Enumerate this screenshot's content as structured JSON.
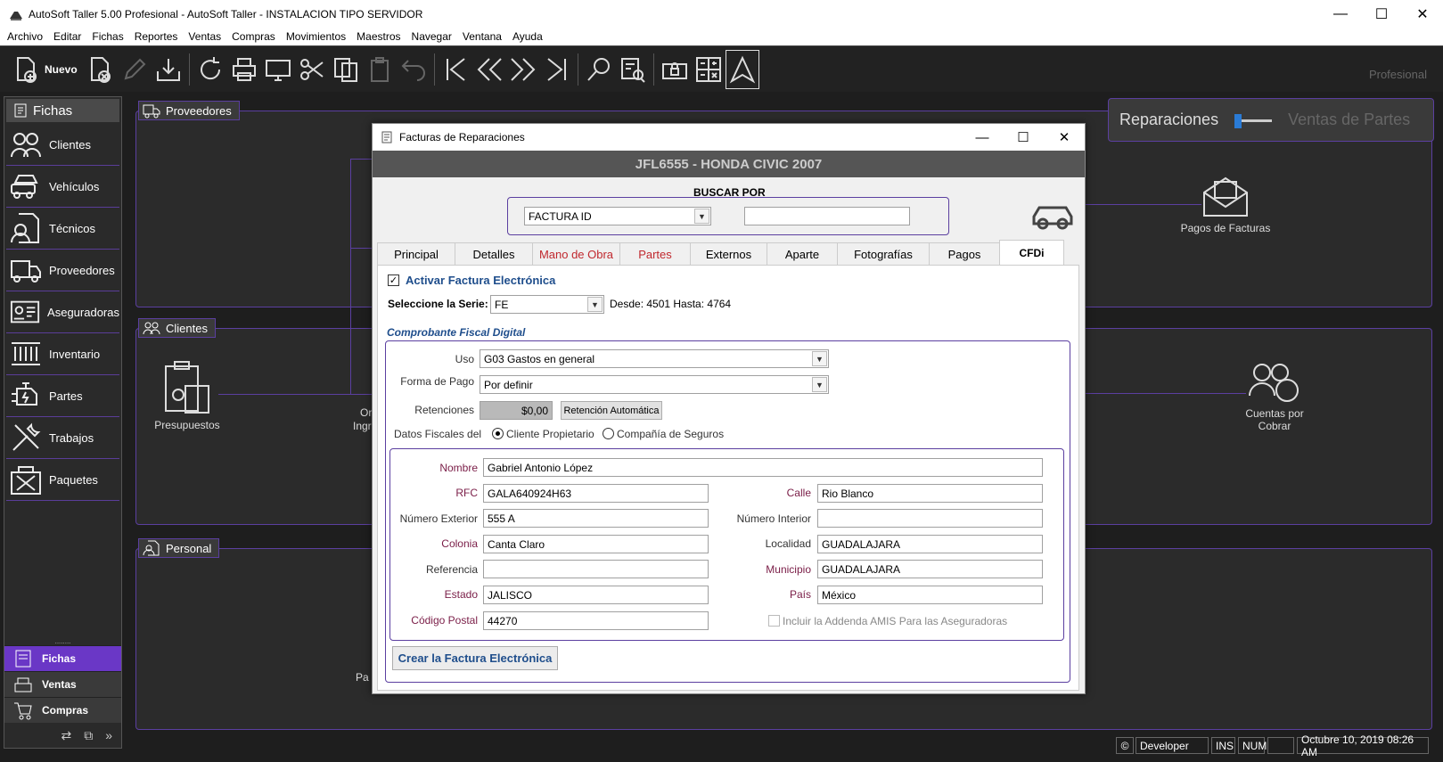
{
  "window": {
    "title": "AutoSoft Taller 5.00 Profesional - AutoSoft Taller - INSTALACION TIPO SERVIDOR",
    "min": "—",
    "max": "☐",
    "close": "✕"
  },
  "menu": [
    "Archivo",
    "Editar",
    "Fichas",
    "Reportes",
    "Ventas",
    "Compras",
    "Movimientos",
    "Maestros",
    "Navegar",
    "Ventana",
    "Ayuda"
  ],
  "toolbar": {
    "new_label": "Nuevo",
    "edition": "Profesional"
  },
  "sidebar": {
    "header": "Fichas",
    "items": [
      "Clientes",
      "Vehículos",
      "Técnicos",
      "Proveedores",
      "Aseguradoras",
      "Inventario",
      "Partes",
      "Trabajos",
      "Paquetes"
    ],
    "grip": "........",
    "bottom": [
      "Fichas",
      "Ventas",
      "Compras"
    ],
    "tools": [
      "⇄",
      "⧉",
      "»"
    ]
  },
  "panels": {
    "proveedores": "Proveedores",
    "clientes": "Clientes",
    "personal": "Personal",
    "pagos_facturas": "Pagos de Facturas",
    "presupuestos": "Presupuestos",
    "cuentas_por_cobrar": "Cuentas por Cobrar",
    "partial_or": "Or",
    "partial_ingr": "Ingr",
    "partial_pa": "Pa"
  },
  "switcher": {
    "left": "Reparaciones",
    "right": "Ventas de Partes"
  },
  "status": {
    "copyright": "©",
    "user": "Developer",
    "ins": "INS",
    "num": "NUM",
    "datetime": "Octubre 10, 2019 08:26 AM"
  },
  "dialog": {
    "title": "Facturas de Reparaciones",
    "banner": "JFL6555 - HONDA CIVIC 2007",
    "search_label": "BUSCAR POR",
    "search_field": "FACTURA ID",
    "search_value": "",
    "tabs": [
      "Principal",
      "Detalles",
      "Mano de Obra",
      "Partes",
      "Externos",
      "Aparte",
      "Fotografías",
      "Pagos",
      "CFDi"
    ],
    "cfdi": {
      "activar_label": "Activar Factura Electrónica",
      "activar_checked": "✓",
      "serie_label": "Seleccione la Serie:",
      "serie": "FE",
      "rango": "Desde: 4501 Hasta: 4764",
      "comprobante_label": "Comprobante Fiscal Digital",
      "uso_label": "Uso",
      "uso": "G03 Gastos en general",
      "forma_pago_label": "Forma de Pago",
      "forma_pago": "Por definir",
      "retenciones_label": "Retenciones",
      "retenciones": "$0,00",
      "retencion_btn": "Retención Automática",
      "datos_label": "Datos Fiscales del",
      "radio_cliente": "Cliente Propietario",
      "radio_compania": "Compañía de Seguros",
      "fields": {
        "nombre_label": "Nombre",
        "nombre": "Gabriel Antonio López",
        "rfc_label": "RFC",
        "rfc": "GALA640924H63",
        "calle_label": "Calle",
        "calle": "Rio Blanco",
        "num_ext_label": "Número Exterior",
        "num_ext": "555 A",
        "num_int_label": "Número Interior",
        "num_int": "",
        "colonia_label": "Colonia",
        "colonia": "Canta Claro",
        "localidad_label": "Localidad",
        "localidad": "GUADALAJARA",
        "referencia_label": "Referencia",
        "referencia": "",
        "municipio_label": "Municipio",
        "municipio": "GUADALAJARA",
        "estado_label": "Estado",
        "estado": "JALISCO",
        "pais_label": "País",
        "pais": "México",
        "cp_label": "Código Postal",
        "cp": "44270"
      },
      "addenda_label": "Incluir la Addenda AMIS Para las Aseguradoras",
      "crear_btn": "Crear la Factura Electrónica"
    }
  },
  "colors": {
    "accent": "#5b3fa0",
    "active": "#6a37c6",
    "required": "#7a1d47",
    "tab_red": "#c0282e",
    "link_blue": "#1f4e8c"
  }
}
